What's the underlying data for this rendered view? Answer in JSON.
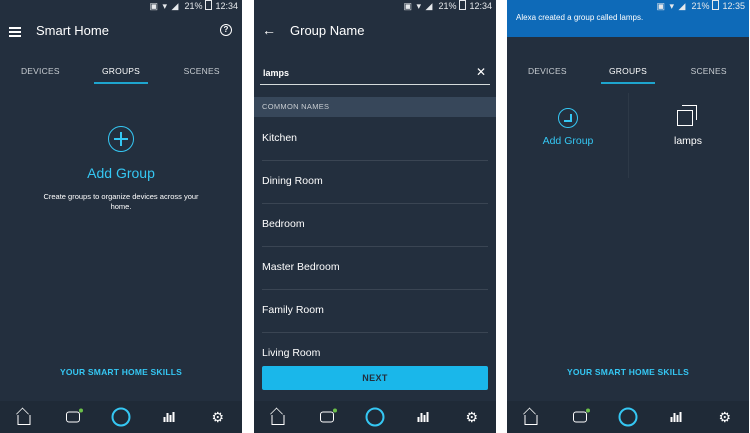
{
  "status": {
    "screen1": {
      "battery": "21%",
      "time": "12:34"
    },
    "screen2": {
      "battery": "21%",
      "time": "12:34"
    },
    "screen3": {
      "battery": "21%",
      "time": "12:35"
    }
  },
  "screen1": {
    "title": "Smart Home",
    "tabs": [
      "DEVICES",
      "GROUPS",
      "SCENES"
    ],
    "active_tab": "GROUPS",
    "add_group_label": "Add Group",
    "description": "Create groups to organize devices across your home.",
    "skills_link": "YOUR SMART HOME SKILLS"
  },
  "screen2": {
    "title": "Group Name",
    "input_value": "lamps",
    "section_header": "COMMON NAMES",
    "names": [
      "Kitchen",
      "Dining Room",
      "Bedroom",
      "Master Bedroom",
      "Family Room",
      "Living Room"
    ],
    "next_label": "NEXT"
  },
  "screen3": {
    "toast": "Alexa created a group called lamps.",
    "tabs": [
      "DEVICES",
      "GROUPS",
      "SCENES"
    ],
    "active_tab": "GROUPS",
    "add_group_label": "Add Group",
    "group_name": "lamps",
    "skills_link": "YOUR SMART HOME SKILLS"
  },
  "bottom_nav": [
    "home-icon",
    "chat-icon",
    "alexa-icon",
    "play-icon",
    "settings-icon"
  ],
  "colors": {
    "background": "#232f3e",
    "accent": "#35c7f3",
    "toast": "#0e6ab8"
  }
}
